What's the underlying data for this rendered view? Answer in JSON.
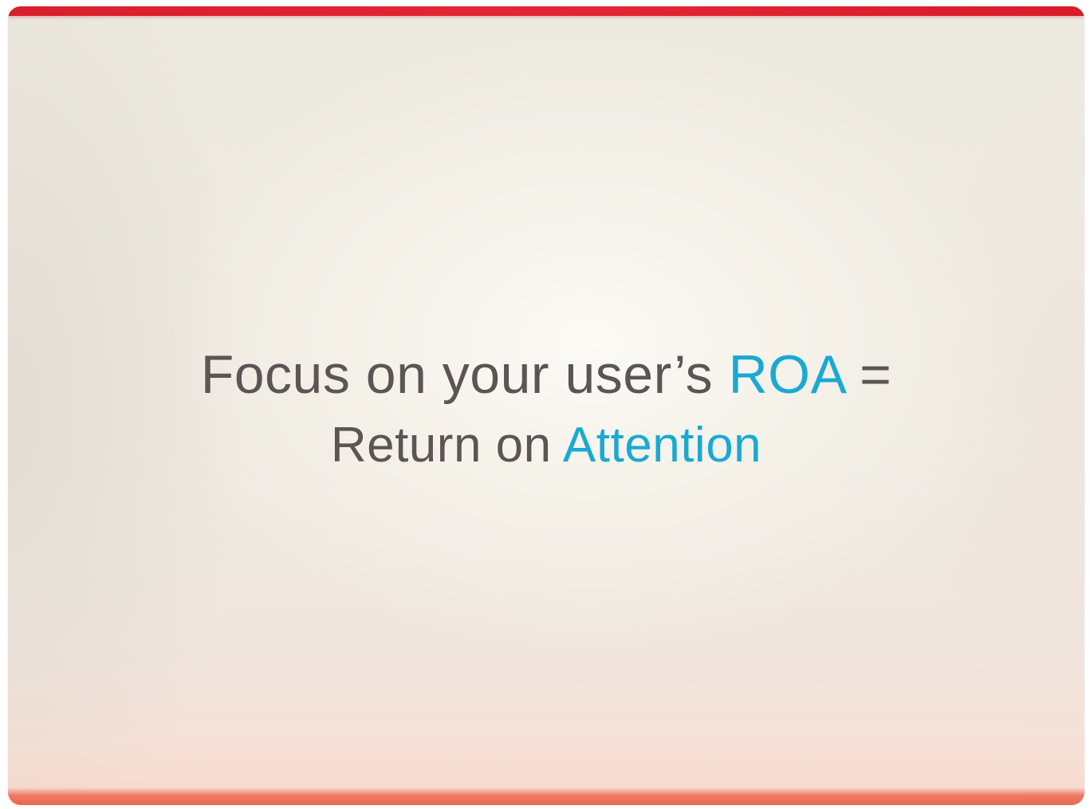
{
  "slide": {
    "line1": {
      "prefix": "Focus on your user’s",
      "highlight": "ROA",
      "suffix": "="
    },
    "line2": {
      "prefix": "Return on",
      "highlight": "Attention"
    }
  },
  "colors": {
    "text": "#5b5555",
    "accent": "#1aa9d4",
    "top_bar": "#e02232",
    "bottom_bar": "#ec735c",
    "background": "#f4f1ea"
  }
}
